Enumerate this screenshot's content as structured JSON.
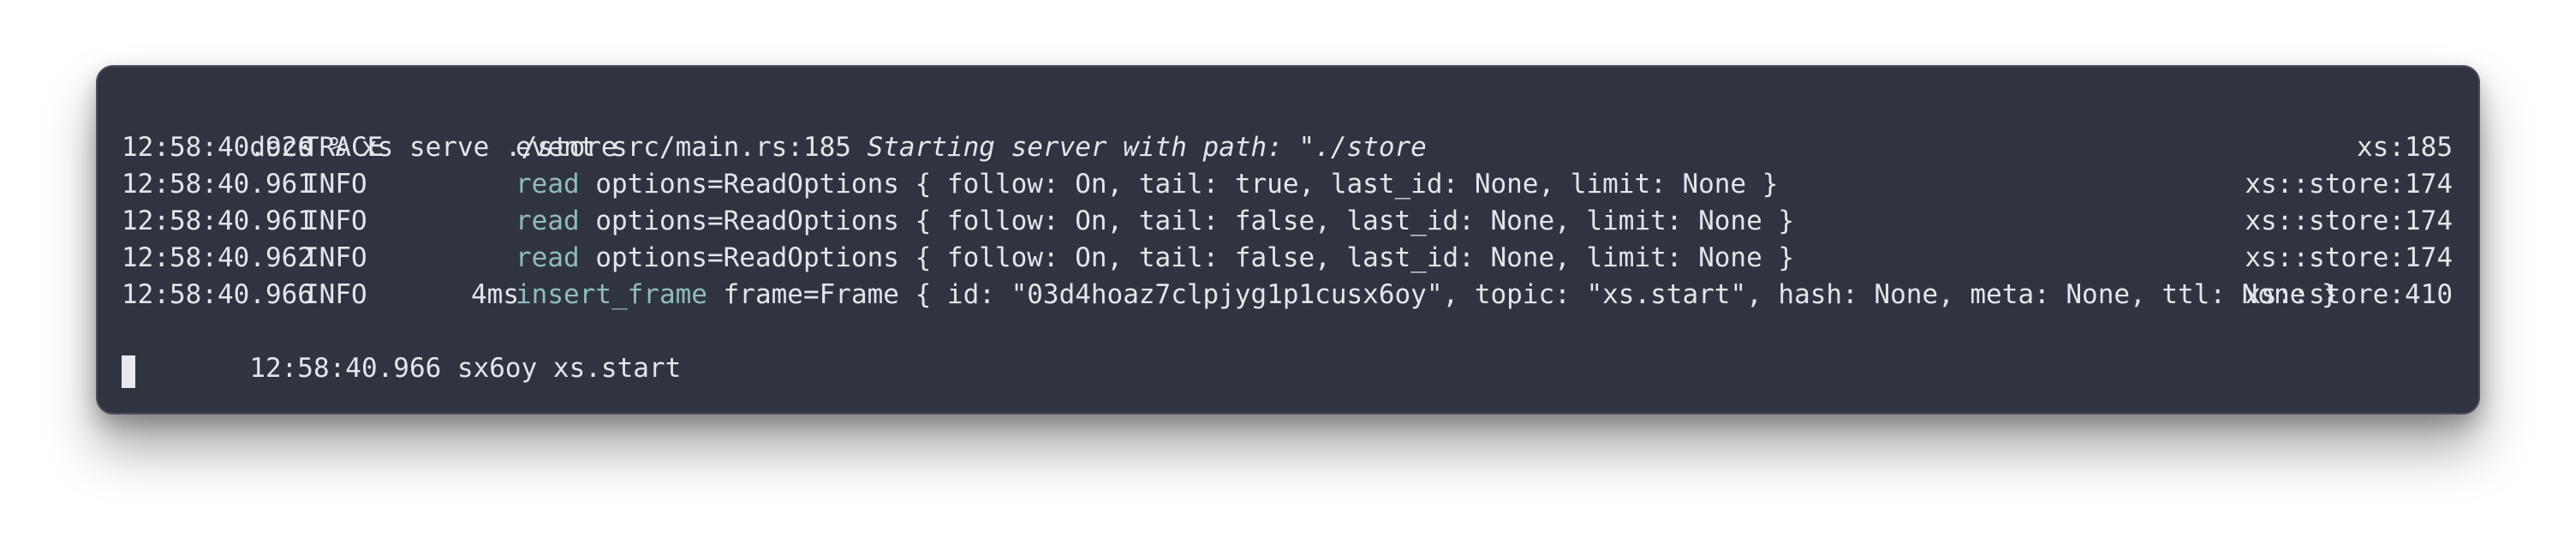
{
  "terminal": {
    "prompt_line": "docs % xs serve ./store",
    "logs": [
      {
        "time": "12:58:40.920",
        "level": "TRACE",
        "duration": "",
        "keyword": "",
        "message_prefix": "event src/main.rs:185 ",
        "message_italic": "Starting server with path: \"./store",
        "message": "",
        "source": "xs:185"
      },
      {
        "time": "12:58:40.961",
        "level": "INFO",
        "duration": "",
        "keyword": "read",
        "message_prefix": "",
        "message_italic": "",
        "message": " options=ReadOptions { follow: On, tail: true, last_id: None, limit: None }",
        "source": "xs::store:174"
      },
      {
        "time": "12:58:40.961",
        "level": "INFO",
        "duration": "",
        "keyword": "read",
        "message_prefix": "",
        "message_italic": "",
        "message": " options=ReadOptions { follow: On, tail: false, last_id: None, limit: None }",
        "source": "xs::store:174"
      },
      {
        "time": "12:58:40.962",
        "level": "INFO",
        "duration": "",
        "keyword": "read",
        "message_prefix": "",
        "message_italic": "",
        "message": " options=ReadOptions { follow: On, tail: false, last_id: None, limit: None }",
        "source": "xs::store:174"
      },
      {
        "time": "12:58:40.966",
        "level": "INFO",
        "duration": "4ms",
        "keyword": "insert_frame",
        "message_prefix": "",
        "message_italic": "",
        "message": " frame=Frame { id: \"03d4hoaz7clpjyg1p1cusx6oy\", topic: \"xs.start\", hash: None, meta: None, ttl: None }",
        "source": "xs::store:410"
      }
    ],
    "output_line": "12:58:40.966 sx6oy xs.start"
  }
}
